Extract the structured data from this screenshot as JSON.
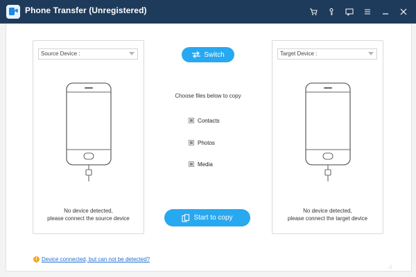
{
  "window": {
    "title": "Phone Transfer (Unregistered)",
    "colors": {
      "titlebar": "#1f3b5b",
      "accent": "#28a8f0",
      "link": "#1f6fcf",
      "warning": "#f5a623"
    },
    "titlebar_icons": [
      "cart-icon",
      "key-icon",
      "chat-icon",
      "menu-icon",
      "minimize-icon",
      "close-icon"
    ]
  },
  "source_panel": {
    "dropdown_label": "Source Device :",
    "status_line1": "No device detected,",
    "status_line2": "please connect the source device"
  },
  "target_panel": {
    "dropdown_label": "Target Device :",
    "status_line1": "No device detected,",
    "status_line2": "please connect the target device"
  },
  "center": {
    "switch_label": "Switch",
    "choose_label": "Choose files below to copy",
    "options": [
      {
        "label": "Contacts"
      },
      {
        "label": "Photos"
      },
      {
        "label": "Media"
      }
    ],
    "start_label": "Start to copy"
  },
  "footer": {
    "help_link": "Device connected, but can not be detected?"
  }
}
